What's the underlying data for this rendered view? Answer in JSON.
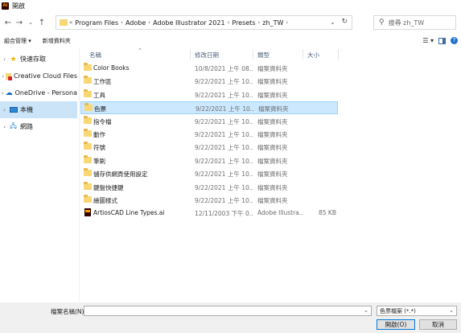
{
  "window": {
    "title": "開啟",
    "app_icon": "Ai"
  },
  "address": {
    "segments": [
      "Program Files",
      "Adobe",
      "Adobe Illustrator 2021",
      "Presets",
      "zh_TW"
    ]
  },
  "search": {
    "placeholder": "搜尋 zh_TW"
  },
  "toolbar": {
    "organize": "組合管理 ▾",
    "new_folder": "新增資料夾"
  },
  "sidebar": {
    "items": [
      {
        "label": "快速存取",
        "icon": "star-icon"
      },
      {
        "label": "Creative Cloud Files",
        "icon": "creative-cloud-icon"
      },
      {
        "label": "OneDrive - Persona",
        "icon": "onedrive-icon"
      },
      {
        "label": "本機",
        "icon": "computer-icon"
      },
      {
        "label": "網路",
        "icon": "network-icon"
      }
    ]
  },
  "columns": {
    "name": "名稱",
    "date": "修改日期",
    "type": "類型",
    "size": "大小"
  },
  "files": [
    {
      "name": "Color Books",
      "date": "10/8/2021 上午 08...",
      "type": "檔案資料夾",
      "size": "",
      "kind": "folder"
    },
    {
      "name": "工作區",
      "date": "9/22/2021 上午 10...",
      "type": "檔案資料夾",
      "size": "",
      "kind": "folder"
    },
    {
      "name": "工具",
      "date": "9/22/2021 上午 10...",
      "type": "檔案資料夾",
      "size": "",
      "kind": "folder"
    },
    {
      "name": "色票",
      "date": "9/22/2021 上午 10...",
      "type": "檔案資料夾",
      "size": "",
      "kind": "folder"
    },
    {
      "name": "指令檔",
      "date": "9/22/2021 上午 10...",
      "type": "檔案資料夾",
      "size": "",
      "kind": "folder"
    },
    {
      "name": "動作",
      "date": "9/22/2021 上午 10...",
      "type": "檔案資料夾",
      "size": "",
      "kind": "folder"
    },
    {
      "name": "符號",
      "date": "9/22/2021 上午 10...",
      "type": "檔案資料夾",
      "size": "",
      "kind": "folder"
    },
    {
      "name": "筆刷",
      "date": "9/22/2021 上午 10...",
      "type": "檔案資料夾",
      "size": "",
      "kind": "folder"
    },
    {
      "name": "儲存供網頁使用設定",
      "date": "9/22/2021 上午 10...",
      "type": "檔案資料夾",
      "size": "",
      "kind": "folder"
    },
    {
      "name": "鍵盤快捷鍵",
      "date": "9/22/2021 上午 10...",
      "type": "檔案資料夾",
      "size": "",
      "kind": "folder"
    },
    {
      "name": "繪圖樣式",
      "date": "9/22/2021 上午 10...",
      "type": "檔案資料夾",
      "size": "",
      "kind": "folder"
    },
    {
      "name": "ArtiosCAD Line Types.ai",
      "date": "12/11/2003 下午 0...",
      "type": "Adobe Illustra...",
      "size": "85 KB",
      "kind": "ai"
    }
  ],
  "selected_row": 3,
  "selected_sidebar": 3,
  "footer": {
    "filename_label": "檔案名稱(N):",
    "filename_value": "",
    "filetype": "色票檔案 (*.*)",
    "open": "開啟(O)",
    "cancel": "取消"
  },
  "colors": {
    "selection": "#cce8ff",
    "sidebar_selection": "#cce4f7",
    "folder": "#f8d775"
  }
}
